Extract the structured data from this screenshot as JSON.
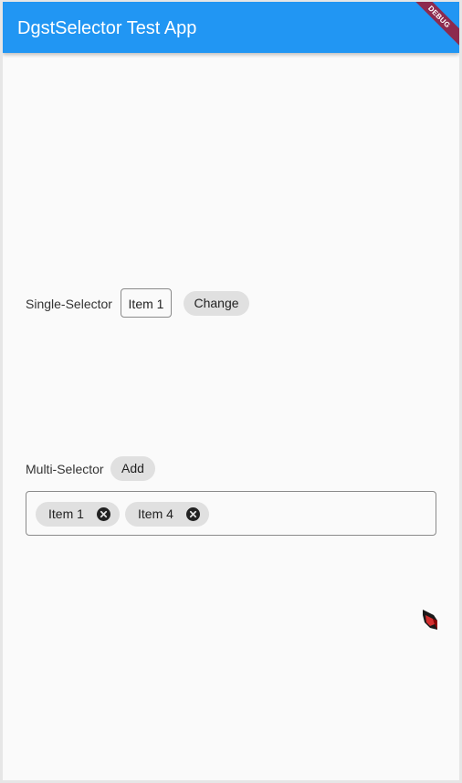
{
  "appbar": {
    "title": "DgstSelector Test App",
    "debug_banner": "DEBUG",
    "color": "#2196f3"
  },
  "single_selector": {
    "label": "Single-Selector",
    "selected_value": "Item 1",
    "change_label": "Change"
  },
  "multi_selector": {
    "label": "Multi-Selector",
    "add_label": "Add",
    "chips": [
      {
        "label": "Item 1",
        "remove_icon": "cancel-circle-icon"
      },
      {
        "label": "Item 4",
        "remove_icon": "cancel-circle-icon"
      }
    ]
  },
  "floating_icon": {
    "icon": "red-cube-icon",
    "color": "#d32f2f"
  }
}
